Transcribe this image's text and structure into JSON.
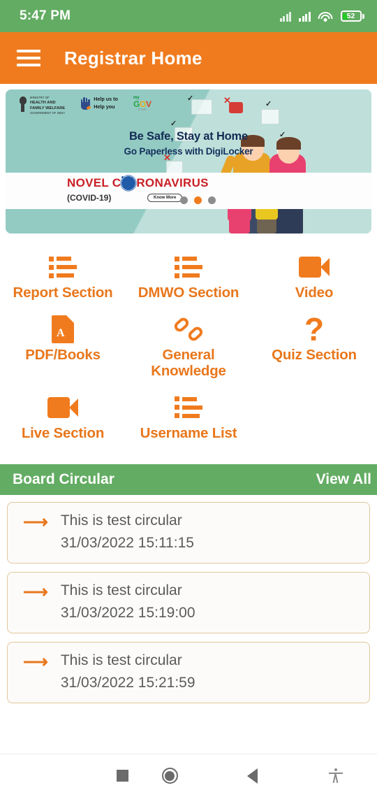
{
  "status_bar": {
    "time": "5:47 PM",
    "battery_percent": "52",
    "signal_icon": "signal-bars-icon",
    "wifi_icon": "wifi-icon",
    "battery_icon": "battery-icon"
  },
  "app_bar": {
    "menu_icon": "hamburger-menu-icon",
    "title": "Registrar Home"
  },
  "banner": {
    "logo_ministry_line1": "MINISTRY OF",
    "logo_ministry_line2": "HEALTH AND",
    "logo_ministry_line3": "FAMILY WELFARE",
    "logo_ministry_line4": "GOVERNMENT OF INDIA",
    "logo_help_line1": "Help us to",
    "logo_help_line2": "Help you",
    "logo_mygov_my": "my",
    "logo_mygov_gov_g": "G",
    "logo_mygov_gov_o": "O",
    "logo_mygov_gov_v": "V",
    "logo_mygov_sub": "मैं भारत",
    "headline": "Be Safe, Stay at Home",
    "subheadline": "Go Paperless with DigiLocker",
    "covid_title_pre": "NOVEL C",
    "covid_title_post": "RONAVIRUS",
    "covid_sub": "(COVID-19)",
    "know_more": "Know More",
    "dots_total": 3,
    "dots_active_index": 1
  },
  "grid": {
    "rows": [
      [
        {
          "label": "Report Section",
          "icon": "list-icon"
        },
        {
          "label": "DMWO Section",
          "icon": "list-icon"
        },
        {
          "label": "Video",
          "icon": "video-camera-icon"
        }
      ],
      [
        {
          "label": "PDF/Books",
          "icon": "pdf-file-icon"
        },
        {
          "label": "General Knowledge",
          "icon": "link-chain-icon"
        },
        {
          "label": "Quiz Section",
          "icon": "question-mark-icon"
        }
      ],
      [
        {
          "label": "Live Section",
          "icon": "video-camera-icon"
        },
        {
          "label": "Username List",
          "icon": "list-icon"
        },
        {
          "label": "",
          "icon": ""
        }
      ]
    ]
  },
  "board_circular": {
    "title": "Board Circular",
    "view_all": "View All",
    "arrow_icon": "arrow-right-icon",
    "items": [
      {
        "title": "This is test circular",
        "date": "31/03/2022 15:11:15"
      },
      {
        "title": "This is test circular",
        "date": "31/03/2022 15:19:00"
      },
      {
        "title": "This is test circular",
        "date": "31/03/2022 15:21:59"
      }
    ]
  },
  "nav_bar": {
    "recents_icon": "recents-square-icon",
    "home_icon": "home-circle-icon",
    "back_icon": "back-triangle-icon",
    "accessibility_icon": "accessibility-icon"
  },
  "colors": {
    "status_green": "#63AC63",
    "app_orange": "#F07B1E",
    "label_orange": "#E8771C",
    "section_green": "#63AC63",
    "card_border": "#E2C79B",
    "banner_teal": "#95CCC4",
    "covid_red": "#C92026"
  }
}
